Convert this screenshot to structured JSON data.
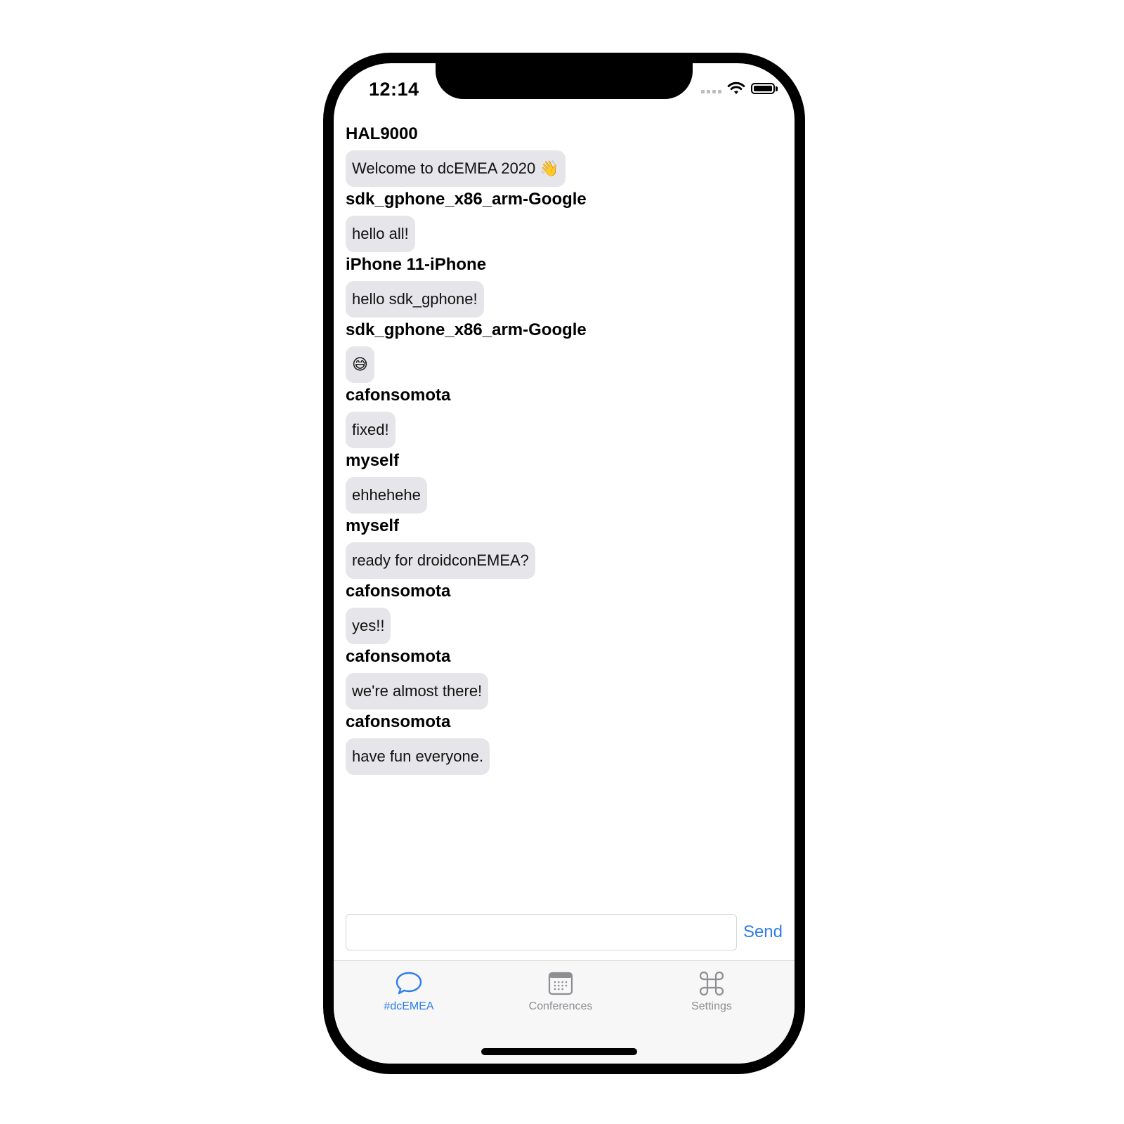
{
  "status_bar": {
    "time": "12:14"
  },
  "messages": [
    {
      "sender": "HAL9000",
      "text": "Welcome to dcEMEA 2020 👋"
    },
    {
      "sender": "sdk_gphone_x86_arm-Google",
      "text": "hello all!"
    },
    {
      "sender": "iPhone 11-iPhone",
      "text": "hello sdk_gphone!"
    },
    {
      "sender": "sdk_gphone_x86_arm-Google",
      "text": "😅"
    },
    {
      "sender": "cafonsomota",
      "text": "fixed!"
    },
    {
      "sender": "myself",
      "text": "ehhehehe"
    },
    {
      "sender": "myself",
      "text": "ready for droidconEMEA?"
    },
    {
      "sender": "cafonsomota",
      "text": "yes!!"
    },
    {
      "sender": "cafonsomota",
      "text": "we're almost there!"
    },
    {
      "sender": "cafonsomota",
      "text": "have fun everyone."
    }
  ],
  "composer": {
    "input_value": "",
    "send_label": "Send"
  },
  "tabs": [
    {
      "label": "#dcEMEA",
      "icon": "chat-bubble-icon",
      "active": true
    },
    {
      "label": "Conferences",
      "icon": "calendar-icon",
      "active": false
    },
    {
      "label": "Settings",
      "icon": "command-icon",
      "active": false
    }
  ],
  "colors": {
    "accent": "#2f7dea",
    "bubble": "#e6e6ea",
    "tab_inactive": "#8e8e93"
  }
}
